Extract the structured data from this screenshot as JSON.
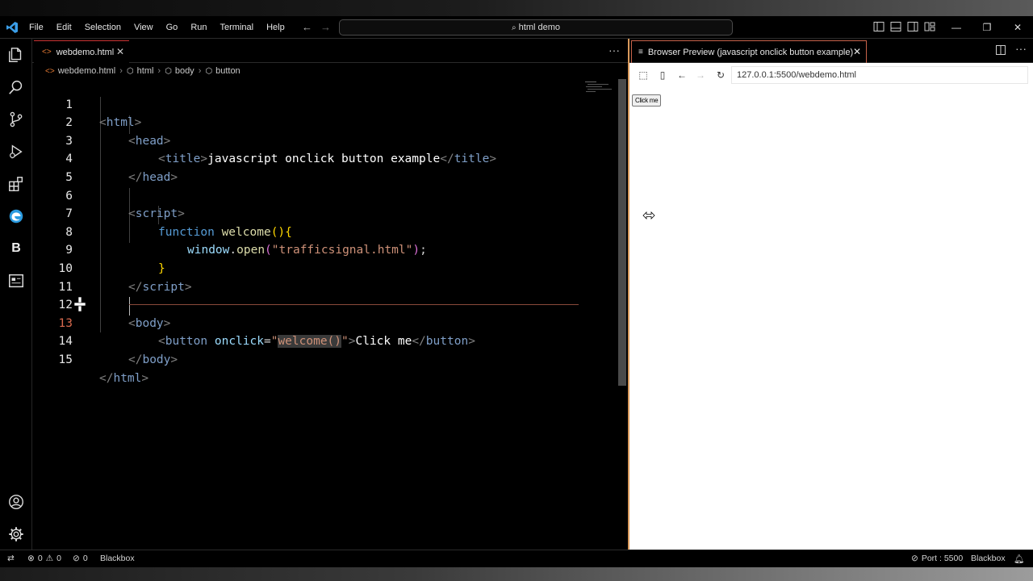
{
  "menu": [
    "File",
    "Edit",
    "Selection",
    "View",
    "Go",
    "Run",
    "Terminal",
    "Help"
  ],
  "command_center": "html demo",
  "editor_tab": {
    "label": "webdemo.html"
  },
  "breadcrumb": [
    "webdemo.html",
    "html",
    "body",
    "button"
  ],
  "code_lines": [
    {
      "n": "1"
    },
    {
      "n": "2"
    },
    {
      "n": "3"
    },
    {
      "n": "4"
    },
    {
      "n": "5"
    },
    {
      "n": "6"
    },
    {
      "n": "7"
    },
    {
      "n": "8"
    },
    {
      "n": "9"
    },
    {
      "n": "10"
    },
    {
      "n": "11"
    },
    {
      "n": "12"
    },
    {
      "n": "13"
    },
    {
      "n": "14"
    },
    {
      "n": "15"
    }
  ],
  "code": {
    "l1": {
      "open": "<",
      "tag": "html",
      "close": ">"
    },
    "l2": {
      "tag": "head"
    },
    "l3": {
      "tag": "title",
      "text": "javascript onclick button example"
    },
    "l4": {
      "tag": "head"
    },
    "l6": {
      "tag": "script"
    },
    "l7": {
      "kw": "function",
      "fn": "welcome",
      "parens": "()",
      "brace": "{"
    },
    "l8": {
      "obj": "window",
      "dot": ".",
      "method": "open",
      "po": "(",
      "str": "\"trafficsignal.html\"",
      "pc": ")",
      "semi": ";"
    },
    "l9": {
      "brace": "}"
    },
    "l10": {
      "tag": "script"
    },
    "l12": {
      "tag": "body"
    },
    "l13": {
      "tag": "button",
      "attr": "onclick",
      "eq": "=",
      "q": "\"",
      "val": "welcome()",
      "text": "Click me"
    },
    "l14": {
      "tag": "body"
    },
    "l15": {
      "tag": "html"
    }
  },
  "preview": {
    "tab_label": "Browser Preview (javascript onclick button example)",
    "url": "127.0.0.1:5500/webdemo.html",
    "button_label": "Click me"
  },
  "status": {
    "errors": "0",
    "warnings": "0",
    "ports": "0",
    "blackbox_left": "Blackbox",
    "port": "Port : 5500",
    "blackbox_right": "Blackbox"
  },
  "colors": {
    "active_line_number": "#d86a4e",
    "tab_accent": "#cc3333",
    "preview_border": "#d99a5c"
  },
  "icons": [
    "vscode-logo-icon",
    "explorer-icon",
    "search-icon",
    "source-control-icon",
    "run-debug-icon",
    "extensions-icon",
    "edge-icon",
    "blackbox-icon",
    "browser-preview-icon",
    "account-icon",
    "settings-gear-icon"
  ]
}
